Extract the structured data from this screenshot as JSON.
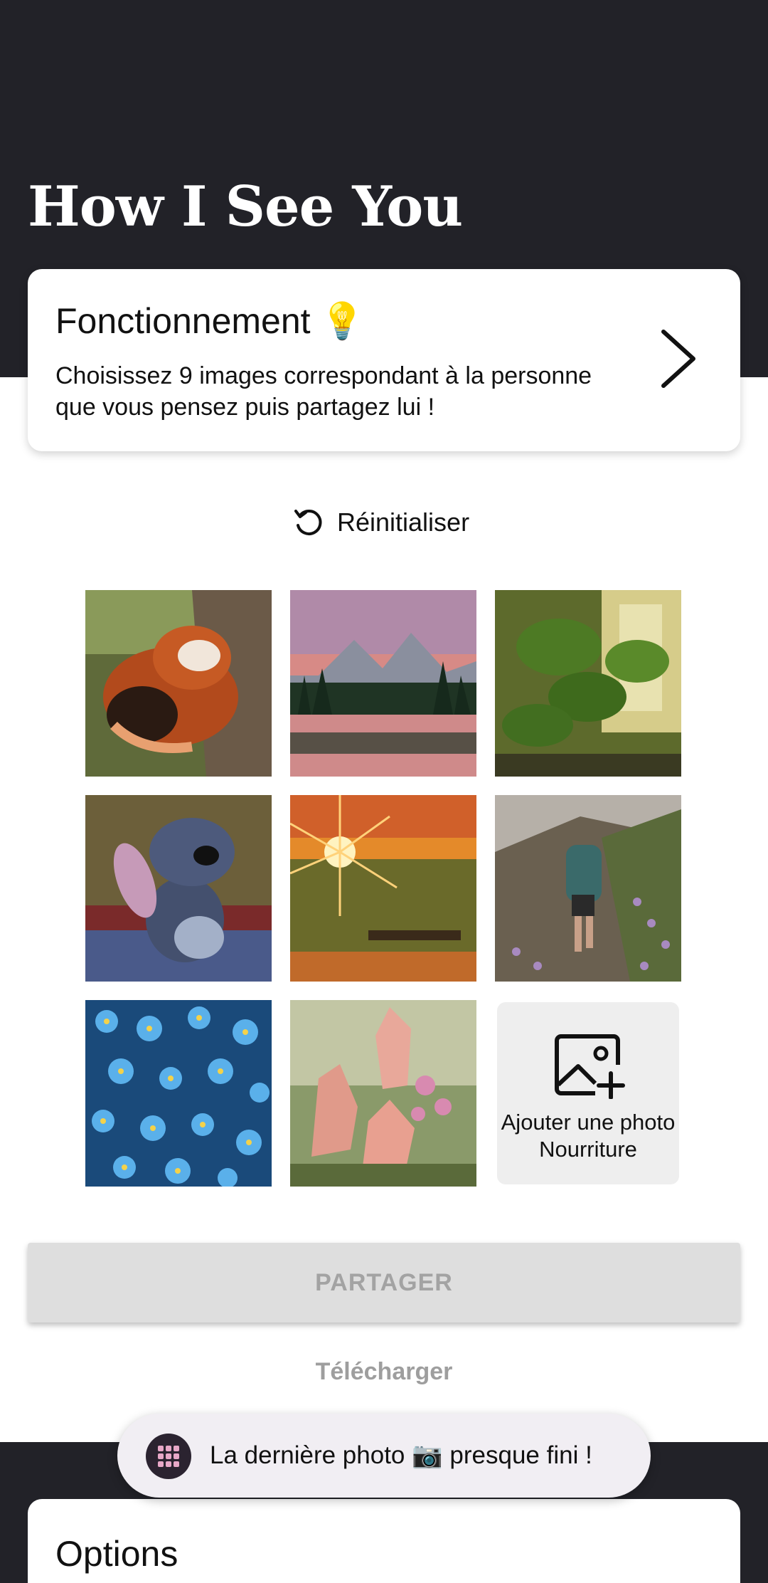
{
  "app": {
    "title": "How I See You"
  },
  "how_it_works": {
    "title": "Fonctionnement 💡",
    "description": "Choisissez 9 images correspondant à la personne que vous pensez puis partagez lui !"
  },
  "reset": {
    "label": "Réinitialiser"
  },
  "grid": {
    "photos": [
      {
        "name": "red-panda-photo"
      },
      {
        "name": "mountain-lake-sunset-photo"
      },
      {
        "name": "monstera-plant-photo"
      },
      {
        "name": "stitch-cartoon-photo"
      },
      {
        "name": "sunset-field-photo"
      },
      {
        "name": "hiker-trail-photo"
      },
      {
        "name": "blue-flowers-photo"
      },
      {
        "name": "pink-crystals-photo"
      }
    ],
    "add_tile": {
      "line1": "Ajouter une photo",
      "line2": "Nourriture"
    }
  },
  "actions": {
    "share_label": "PARTAGER",
    "download_label": "Télécharger"
  },
  "options": {
    "title": "Options"
  },
  "toast": {
    "text": "La dernière photo 📷 presque fini !"
  },
  "colors": {
    "dark_band": "#222228",
    "disabled_button": "#dedede",
    "disabled_text": "#a3a3a3"
  }
}
